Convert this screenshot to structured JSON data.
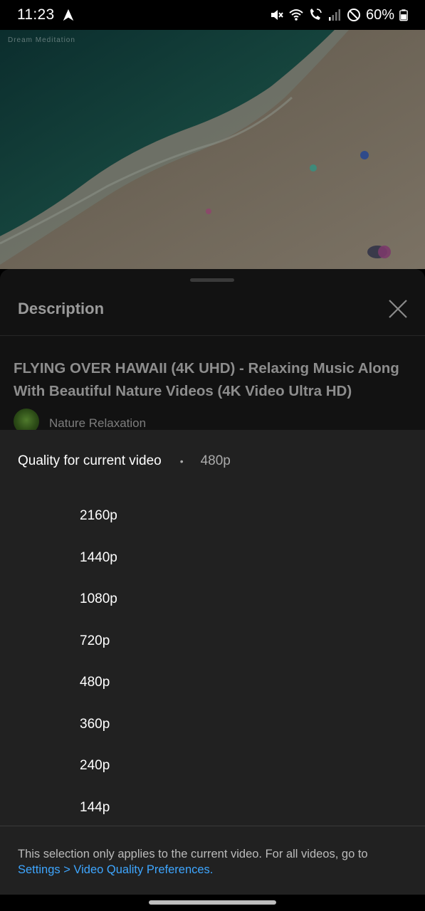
{
  "status_bar": {
    "time": "11:23",
    "battery": "60%",
    "icons": [
      "navigation-icon",
      "mute-icon",
      "wifi-icon",
      "wifi-calling-icon",
      "signal-icon",
      "do-not-disturb-icon",
      "battery-icon"
    ]
  },
  "video": {
    "watermark": "Dream Meditation"
  },
  "description_panel": {
    "title": "Description",
    "video_title": "FLYING OVER HAWAII (4K UHD) - Relaxing Music Along With Beautiful Nature Videos (4K Video Ultra HD)",
    "channel_name": "Nature Relaxation"
  },
  "quality_sheet": {
    "header_label": "Quality for current video",
    "separator": "•",
    "current_quality": "480p",
    "options": [
      "2160p",
      "1440p",
      "1080p",
      "720p",
      "480p",
      "360p",
      "240p",
      "144p"
    ],
    "footer_text": "This selection only applies to the current video. For all videos, go to",
    "footer_link": "Settings > Video Quality Preferences."
  },
  "colors": {
    "sheet_background": "#212121",
    "link": "#3ea6ff",
    "description_background": "#121212"
  }
}
